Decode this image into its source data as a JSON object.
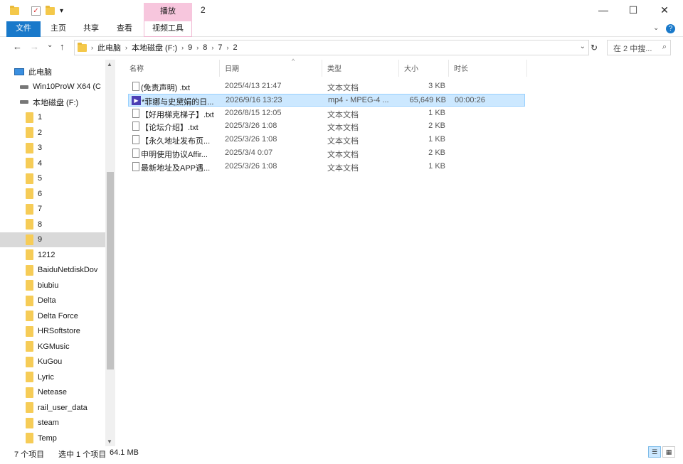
{
  "title_bar": {
    "context_tab_label": "播放",
    "window_title": "2",
    "quick_access_dropdown": "▾",
    "minimize": "—",
    "maximize": "☐",
    "close": "✕"
  },
  "ribbon": {
    "tabs": [
      "文件",
      "主页",
      "共享",
      "查看",
      "视频工具"
    ],
    "collapse_chevron": "⌄",
    "help": "?"
  },
  "address": {
    "back": "←",
    "forward": "→",
    "recent": "⌄",
    "up": "↑",
    "path": [
      "此电脑",
      "本地磁盘 (F:)",
      "9",
      "8",
      "7",
      "2"
    ],
    "dropdown": "⌄",
    "refresh": "↻",
    "search_placeholder": "在 2 中搜..."
  },
  "nav": {
    "items": [
      {
        "label": "此电脑",
        "kind": "pc"
      },
      {
        "label": "Win10ProW X64 (C",
        "kind": "drive"
      },
      {
        "label": "本地磁盘 (F:)",
        "kind": "drive"
      },
      {
        "label": "1",
        "kind": "folder"
      },
      {
        "label": "2",
        "kind": "folder"
      },
      {
        "label": "3",
        "kind": "folder"
      },
      {
        "label": "4",
        "kind": "folder"
      },
      {
        "label": "5",
        "kind": "folder"
      },
      {
        "label": "6",
        "kind": "folder"
      },
      {
        "label": "7",
        "kind": "folder"
      },
      {
        "label": "8",
        "kind": "folder"
      },
      {
        "label": "9",
        "kind": "folder",
        "selected": true
      },
      {
        "label": "1212",
        "kind": "folder"
      },
      {
        "label": "BaiduNetdiskDov",
        "kind": "folder"
      },
      {
        "label": "biubiu",
        "kind": "folder"
      },
      {
        "label": "Delta",
        "kind": "folder"
      },
      {
        "label": "Delta Force",
        "kind": "folder"
      },
      {
        "label": "HRSoftstore",
        "kind": "folder"
      },
      {
        "label": "KGMusic",
        "kind": "folder"
      },
      {
        "label": "KuGou",
        "kind": "folder"
      },
      {
        "label": "Lyric",
        "kind": "folder"
      },
      {
        "label": "Netease",
        "kind": "folder"
      },
      {
        "label": "rail_user_data",
        "kind": "folder"
      },
      {
        "label": "steam",
        "kind": "folder"
      },
      {
        "label": "Temp",
        "kind": "folder"
      }
    ]
  },
  "list": {
    "columns": [
      "名称",
      "日期",
      "类型",
      "大小",
      "时长"
    ],
    "rows": [
      {
        "name": "(免责声明) .txt",
        "date": "2025/4/13 21:47",
        "type": "文本文档",
        "size": "3 KB",
        "duration": "",
        "icon": "doc"
      },
      {
        "name": "*菲娜与史黛娟的日...",
        "date": "2026/9/16 13:23",
        "type": "mp4 - MPEG-4 ...",
        "size": "65,649 KB",
        "duration": "00:00:26",
        "icon": "video",
        "selected": true
      },
      {
        "name": "【好用梯克梯子】.txt",
        "date": "2026/8/15 12:05",
        "type": "文本文档",
        "size": "1 KB",
        "duration": "",
        "icon": "doc"
      },
      {
        "name": "【论坛介绍】.txt",
        "date": "2025/3/26 1:08",
        "type": "文本文档",
        "size": "2 KB",
        "duration": "",
        "icon": "doc"
      },
      {
        "name": "【永久地址发布页...",
        "date": "2025/3/26 1:08",
        "type": "文本文档",
        "size": "1 KB",
        "duration": "",
        "icon": "doc"
      },
      {
        "name": "申明使用协议Affir...",
        "date": "2025/3/4 0:07",
        "type": "文本文档",
        "size": "2 KB",
        "duration": "",
        "icon": "doc"
      },
      {
        "name": "最新地址及APP遇...",
        "date": "2025/3/26 1:08",
        "type": "文本文档",
        "size": "1 KB",
        "duration": "",
        "icon": "doc"
      }
    ]
  },
  "status": {
    "item_count": "7 个项目",
    "selected": "选中 1 个项目",
    "size": "64.1 MB"
  }
}
